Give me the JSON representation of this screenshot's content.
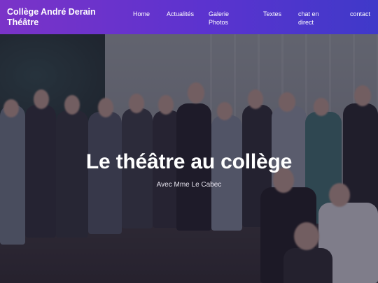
{
  "header": {
    "site_title": "Collège André Derain Théâtre",
    "nav": [
      {
        "label": "Home"
      },
      {
        "label": "Actualités"
      },
      {
        "label": "Galerie Photos"
      },
      {
        "label": "Textes"
      },
      {
        "label": "chat en direct"
      },
      {
        "label": "contact"
      }
    ]
  },
  "hero": {
    "title": "Le théâtre au collège",
    "subtitle": "Avec Mme Le Cabec"
  },
  "colors": {
    "header_gradient_start": "#7b33c8",
    "header_gradient_end": "#3f39c9",
    "text": "#ffffff"
  }
}
